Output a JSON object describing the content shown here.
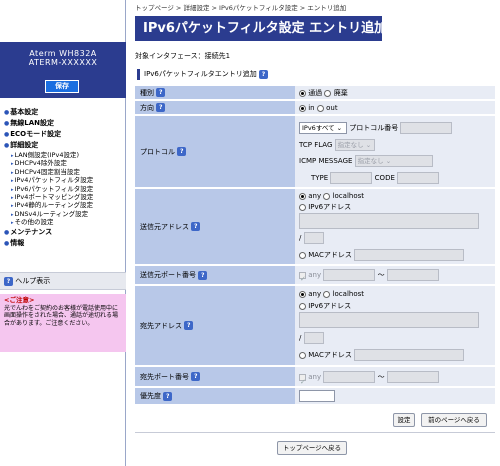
{
  "breadcrumb": "トップページ > 詳細設定 > IPv6パケットフィルタ設定 > エントリ追加",
  "title": "IPv6パケットフィルタ設定 エントリ追加",
  "sidebar": {
    "model": "Aterm WH832A",
    "model_sub": "ATERM-XXXXXX",
    "save_label": "保存",
    "nav": [
      {
        "label": "基本設定"
      },
      {
        "label": "無線LAN設定"
      },
      {
        "label": "ECOモード設定"
      },
      {
        "label": "詳細設定"
      }
    ],
    "sub_items": [
      "LAN側設定(IPv4設定)",
      "DHCPv4除外設定",
      "DHCPv4固定割当設定",
      "IPv4パケットフィルタ設定",
      "IPv6パケットフィルタ設定",
      "IPv4ポートマッピング設定",
      "IPv4静的ルーティング設定",
      "DNSv4ルーティング設定",
      "その他の設定"
    ],
    "nav_after": [
      {
        "label": "メンテナンス"
      },
      {
        "label": "情報"
      }
    ],
    "help_label": "ヘルプ表示",
    "notice_title": "<ご注意>",
    "notice_text": "光でんわをご契約のお客様が電話使用中に画面操作をされた場合、通話が途切れる場合があります。ご注意ください。"
  },
  "interface_label": "対象インタフェース：接続先1",
  "section_title": "IPv6パケットフィルタエントリ追加",
  "help_icon": "?",
  "form": {
    "type": {
      "label": "種別",
      "opt1": "通過",
      "opt2": "廃棄"
    },
    "direction": {
      "label": "方向",
      "opt1": "in",
      "opt2": "out"
    },
    "protocol": {
      "label": "プロトコル",
      "select_value": "IPv6すべて",
      "number_label": "プロトコル番号",
      "tcp_flag_label": "TCP FLAG",
      "tcp_flag_value": "指定なし",
      "icmp_label": "ICMP MESSAGE",
      "icmp_value": "指定なし",
      "type_label": "TYPE",
      "code_label": "CODE"
    },
    "src_addr": {
      "label": "送信元アドレス",
      "opt_any": "any",
      "opt_local": "localhost",
      "opt_ipv6": "IPv6アドレス",
      "slash": "/",
      "opt_mac": "MACアドレス"
    },
    "src_port": {
      "label": "送信元ポート番号",
      "any": "any",
      "dash": "〜"
    },
    "dst_addr": {
      "label": "宛先アドレス",
      "opt_any": "any",
      "opt_local": "localhost",
      "opt_ipv6": "IPv6アドレス",
      "slash": "/",
      "opt_mac": "MACアドレス"
    },
    "dst_port": {
      "label": "宛先ポート番号",
      "any": "any",
      "dash": "〜"
    },
    "priority": {
      "label": "優先度"
    }
  },
  "buttons": {
    "set": "設定",
    "back": "前のページへ戻る",
    "top": "トップページへ戻る"
  }
}
